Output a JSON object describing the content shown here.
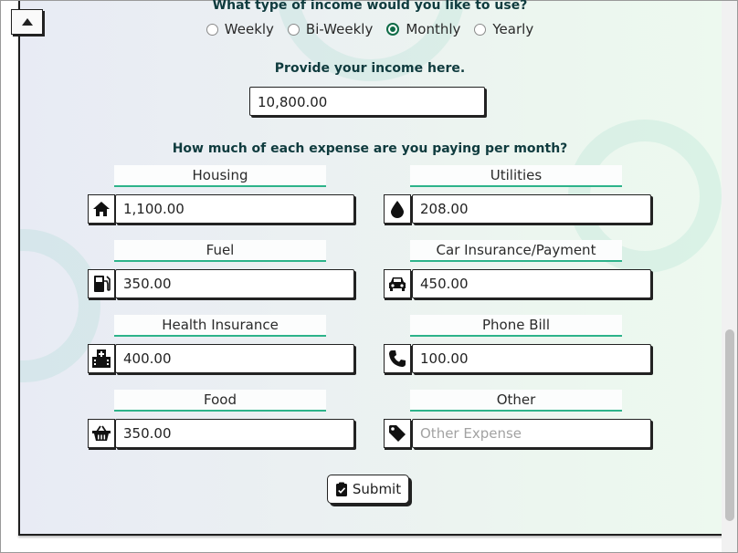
{
  "income_type": {
    "question": "What type of income would you like to use?",
    "options": [
      {
        "label": "Weekly",
        "checked": false
      },
      {
        "label": "Bi-Weekly",
        "checked": false
      },
      {
        "label": "Monthly",
        "checked": true
      },
      {
        "label": "Yearly",
        "checked": false
      }
    ]
  },
  "income": {
    "prompt": "Provide your income here.",
    "value": "10,800.00"
  },
  "expenses": {
    "question_prefix": "How much of each expense are you paying ",
    "question_emphasis": "per month?",
    "items": [
      {
        "label": "Housing",
        "value": "1,100.00",
        "icon": "home-icon"
      },
      {
        "label": "Utilities",
        "value": "208.00",
        "icon": "water-drop-icon"
      },
      {
        "label": "Fuel",
        "value": "350.00",
        "icon": "gas-pump-icon"
      },
      {
        "label": "Car Insurance/Payment",
        "value": "450.00",
        "icon": "car-icon"
      },
      {
        "label": "Health Insurance",
        "value": "400.00",
        "icon": "hospital-icon"
      },
      {
        "label": "Phone Bill",
        "value": "100.00",
        "icon": "phone-icon"
      },
      {
        "label": "Food",
        "value": "350.00",
        "icon": "basket-icon"
      },
      {
        "label": "Other",
        "value": "",
        "placeholder": "Other Expense",
        "icon": "tag-icon"
      }
    ]
  },
  "submit": {
    "label": "Submit",
    "icon": "clipboard-check-icon"
  },
  "colors": {
    "accent": "#2db38a",
    "heading": "#0f3b3e",
    "radio_checked": "#0f6b47"
  }
}
